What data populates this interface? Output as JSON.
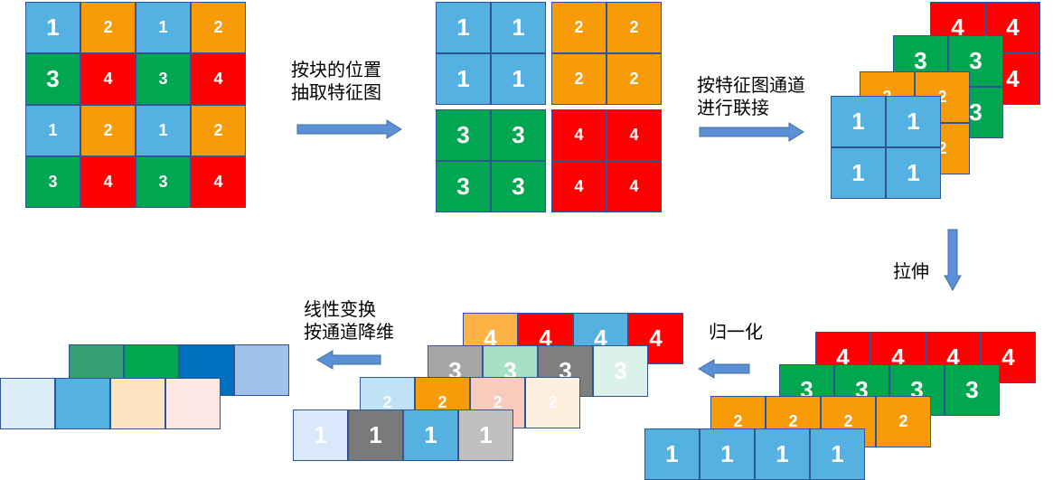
{
  "colors": {
    "v1": "#56b1e3",
    "v2": "#f79b09",
    "v3": "#00a650",
    "v4": "#ff0000",
    "cell_border": "#2f5597",
    "arrow": "#5b8fd6",
    "arrow_edge": "#41719c"
  },
  "labels": {
    "step_extract": [
      "按块的位置",
      "抽取特征图"
    ],
    "step_concat": [
      "按特征图通道",
      "进行联接"
    ],
    "step_flatten": [
      "拉伸"
    ],
    "step_normalize": [
      "归一化"
    ],
    "step_linear": [
      "线性变换",
      "按通道降维"
    ]
  },
  "input_grid": {
    "rows": [
      [
        "1",
        "2",
        "1",
        "2"
      ],
      [
        "3",
        "4",
        "3",
        "4"
      ],
      [
        "1",
        "2",
        "1",
        "2"
      ],
      [
        "3",
        "4",
        "3",
        "4"
      ]
    ]
  },
  "split_maps": [
    {
      "value": "1",
      "color_key": "v1"
    },
    {
      "value": "2",
      "color_key": "v2"
    },
    {
      "value": "3",
      "color_key": "v3"
    },
    {
      "value": "4",
      "color_key": "v4"
    }
  ],
  "stacked_layers": [
    {
      "value": "4",
      "color_key": "v4"
    },
    {
      "value": "3",
      "color_key": "v3"
    },
    {
      "value": "2",
      "color_key": "v2"
    },
    {
      "value": "1",
      "color_key": "v1"
    }
  ],
  "flattened_rows": [
    {
      "value": "4",
      "color_key": "v4"
    },
    {
      "value": "3",
      "color_key": "v3"
    },
    {
      "value": "2",
      "color_key": "v2"
    },
    {
      "value": "1",
      "color_key": "v1"
    }
  ],
  "normalized_rows": [
    {
      "value": "4",
      "colors": [
        "#ffb347",
        "#ff0000",
        "#56b1e3",
        "#ff0000"
      ]
    },
    {
      "value": "3",
      "colors": [
        "#a6a6a6",
        "#a8e0c4",
        "#7f7f7f",
        "#daf2e8"
      ]
    },
    {
      "value": "2",
      "colors": [
        "#bfe3f5",
        "#f79b09",
        "#f8cbbd",
        "#fdeedd"
      ]
    },
    {
      "value": "1",
      "colors": [
        "#dae8fc",
        "#7a7a7a",
        "#56b1e3",
        "#bfbfbf"
      ]
    }
  ],
  "output_rows": [
    {
      "colors": [
        "#33a070",
        "#00a650",
        "#0070c0",
        "#a1c1ed"
      ]
    },
    {
      "colors": [
        "#dbeef9",
        "#56b1e3",
        "#fde3c3",
        "#fbe8e4"
      ]
    }
  ]
}
